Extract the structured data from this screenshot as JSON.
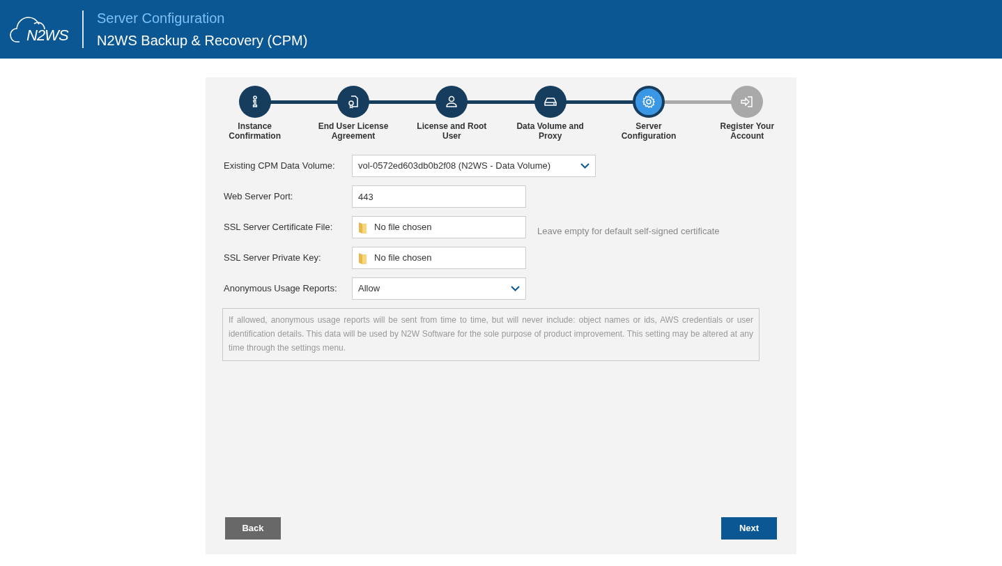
{
  "header": {
    "logo": "N2WS",
    "page_title": "Server Configuration",
    "product": "N2WS Backup & Recovery (CPM)"
  },
  "steps": [
    {
      "label": "Instance Confirmation",
      "kind": "done"
    },
    {
      "label": "End User License Agreement",
      "kind": "done"
    },
    {
      "label": "License and Root User",
      "kind": "done"
    },
    {
      "label": "Data Volume and Proxy",
      "kind": "done"
    },
    {
      "label": "Server Configuration",
      "kind": "current"
    },
    {
      "label": "Register Your Account",
      "kind": "pending"
    }
  ],
  "fields": [
    {
      "label": "Existing CPM Data Volume:",
      "kind": "select",
      "value": "vol-0572ed603db0b2f08 (N2WS - Data Volume)"
    },
    {
      "label": "Web Server Port:",
      "kind": "text",
      "value": "443"
    },
    {
      "label": "SSL Server Certificate File:",
      "kind": "file",
      "value": "No file chosen",
      "hint": "Leave empty for default self-signed certificate"
    },
    {
      "label": "SSL Server Private Key:",
      "kind": "file",
      "value": "No file chosen"
    },
    {
      "label": "Anonymous Usage Reports:",
      "kind": "select",
      "value": "Allow"
    }
  ],
  "notice": "If allowed, anonymous usage reports will be sent from time to time, but will never include: object names or ids, AWS credentials or user identification details. This data will be used by N2W Software for the sole purpose of product improvement. This setting may be altered at any time through the settings menu.",
  "buttons": [
    {
      "label": "Back",
      "kind": "secondary"
    },
    {
      "label": "Next",
      "kind": "primary"
    }
  ]
}
